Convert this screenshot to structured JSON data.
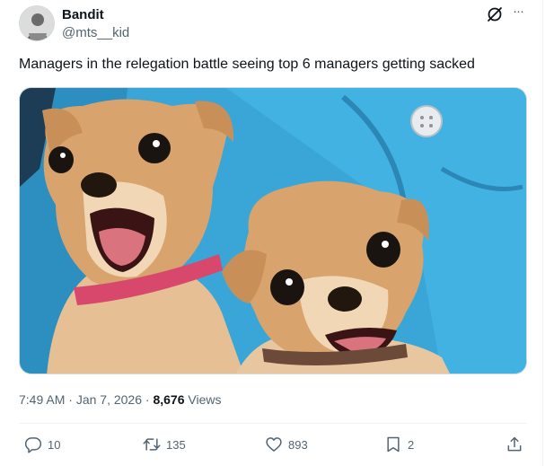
{
  "author": {
    "display_name": "Bandit",
    "handle": "@mts__kid",
    "avatar_icon": "avatar-image"
  },
  "header_icons": [
    "grok-icon",
    "more-icon"
  ],
  "tweet": {
    "text": "Managers in the relegation battle seeing top 6 managers getting sacked",
    "media_alt": "two-chihuahuas-shocked-photo"
  },
  "meta": {
    "time": "7:49 AM",
    "separator1": " · ",
    "date": "Jan 7, 2026",
    "separator2": " · ",
    "views_count": "8,676",
    "views_label": " Views"
  },
  "actions": {
    "reply": {
      "icon": "reply-icon",
      "count": "10"
    },
    "retweet": {
      "icon": "retweet-icon",
      "count": "135"
    },
    "like": {
      "icon": "heart-icon",
      "count": "893"
    },
    "bookmark": {
      "icon": "bookmark-icon",
      "count": "2"
    },
    "share": {
      "icon": "share-icon",
      "count": ""
    }
  },
  "colors": {
    "text_primary": "#0f1419",
    "text_secondary": "#536471",
    "divider": "#eff3f4",
    "background": "#ffffff"
  }
}
